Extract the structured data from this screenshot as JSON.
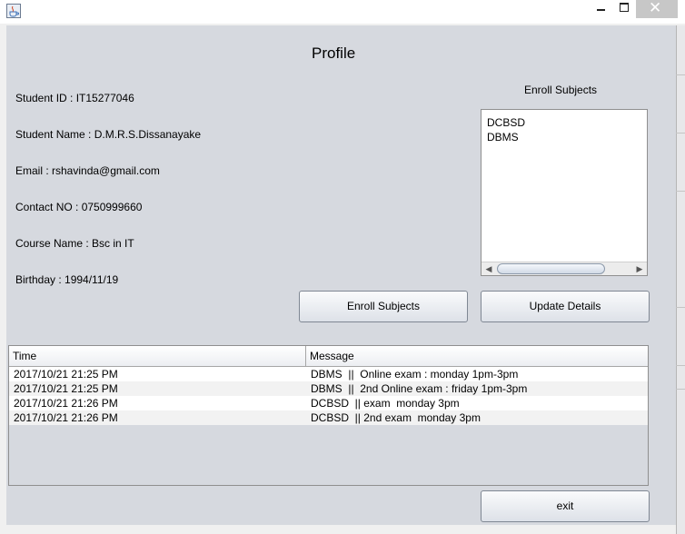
{
  "window": {
    "icon": "java-cup-icon"
  },
  "profile": {
    "heading": "Profile",
    "student_id": "Student ID : IT15277046",
    "student_name": "Student Name : D.M.R.S.Dissanayake",
    "email": "Email : rshavinda@gmail.com",
    "contact": "Contact NO : 0750999660",
    "course": "Course Name : Bsc in IT",
    "birthday": "Birthday : 1994/11/19"
  },
  "enroll": {
    "title": "Enroll Subjects",
    "subjects": [
      "DCBSD",
      "DBMS"
    ]
  },
  "buttons": {
    "enroll": "Enroll Subjects",
    "update": "Update Details",
    "exit": "exit"
  },
  "table": {
    "columns": [
      "Time",
      "Message"
    ],
    "rows": [
      {
        "time": "2017/10/21 21:25 PM",
        "message": "DBMS  ||  Online exam : monday 1pm-3pm"
      },
      {
        "time": "2017/10/21 21:25 PM",
        "message": "DBMS  ||  2nd Online exam : friday 1pm-3pm"
      },
      {
        "time": "2017/10/21 21:26 PM",
        "message": "DCBSD  || exam  monday 3pm"
      },
      {
        "time": "2017/10/21 21:26 PM",
        "message": "DCBSD  || 2nd exam  monday 3pm"
      }
    ]
  }
}
